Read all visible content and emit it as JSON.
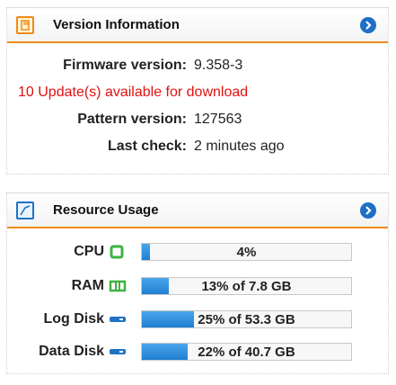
{
  "version_panel": {
    "title": "Version Information",
    "rows": [
      {
        "label": "Firmware version:",
        "value": "9.358-3"
      },
      {
        "label": "Pattern version:",
        "value": "127563"
      },
      {
        "label": "Last check:",
        "value": "2 minutes ago"
      }
    ],
    "alert": "10 Update(s) available for download",
    "accent_color": "#f08a1a",
    "alert_color": "#e01010",
    "icon": "tabs-orange-icon",
    "action_icon": "chevron-right-circle-icon"
  },
  "resource_panel": {
    "title": "Resource Usage",
    "icon": "resource-window-icon",
    "action_icon": "chevron-right-circle-icon",
    "bar_color": "#1f7fd1",
    "rows": [
      {
        "label": "CPU",
        "icon": "cpu-chip-icon",
        "percent": 4,
        "text": "4%"
      },
      {
        "label": "RAM",
        "icon": "ram-module-icon",
        "percent": 13,
        "text": "13% of 7.8 GB"
      },
      {
        "label": "Log Disk",
        "icon": "disk-drive-icon",
        "percent": 25,
        "text": "25% of 53.3 GB"
      },
      {
        "label": "Data Disk",
        "icon": "disk-drive-icon",
        "percent": 22,
        "text": "22% of 40.7 GB"
      }
    ]
  }
}
